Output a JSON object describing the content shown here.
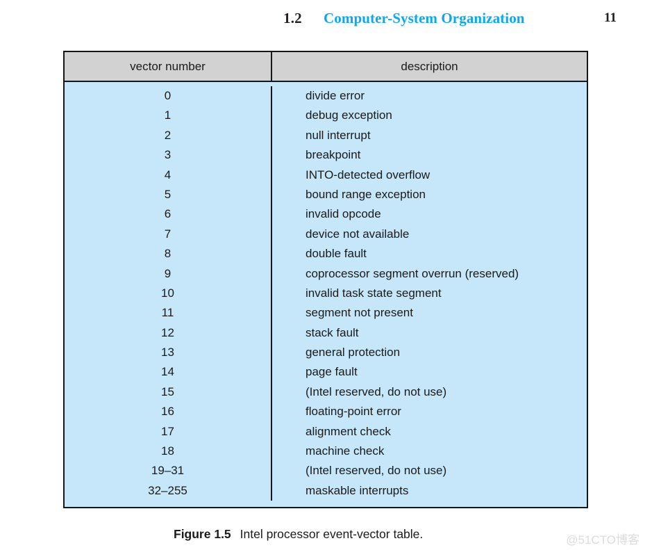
{
  "header": {
    "section_number": "1.2",
    "section_title": "Computer-System Organization",
    "page_number": "11",
    "title_color": "#0aa8f0"
  },
  "table": {
    "header_bg": "#d2d2d2",
    "body_bg": "#c6e7fa",
    "border_color": "#14161a",
    "columns": [
      "vector number",
      "description"
    ],
    "rows": [
      {
        "vector": "0",
        "description": "divide error"
      },
      {
        "vector": "1",
        "description": "debug exception"
      },
      {
        "vector": "2",
        "description": "null interrupt"
      },
      {
        "vector": "3",
        "description": "breakpoint"
      },
      {
        "vector": "4",
        "description": "INTO-detected overflow"
      },
      {
        "vector": "5",
        "description": "bound range exception"
      },
      {
        "vector": "6",
        "description": "invalid opcode"
      },
      {
        "vector": "7",
        "description": "device not available"
      },
      {
        "vector": "8",
        "description": "double fault"
      },
      {
        "vector": "9",
        "description": "coprocessor segment overrun (reserved)"
      },
      {
        "vector": "10",
        "description": "invalid task state segment"
      },
      {
        "vector": "11",
        "description": "segment not present"
      },
      {
        "vector": "12",
        "description": "stack fault"
      },
      {
        "vector": "13",
        "description": "general protection"
      },
      {
        "vector": "14",
        "description": "page fault"
      },
      {
        "vector": "15",
        "description": "(Intel reserved, do not use)"
      },
      {
        "vector": "16",
        "description": "floating-point error"
      },
      {
        "vector": "17",
        "description": "alignment check"
      },
      {
        "vector": "18",
        "description": "machine check"
      },
      {
        "vector": "19–31",
        "description": "(Intel reserved, do not use)"
      },
      {
        "vector": "32–255",
        "description": "maskable interrupts"
      }
    ]
  },
  "caption": {
    "label": "Figure 1.5",
    "text": "Intel processor event-vector table."
  },
  "watermark": {
    "text": "@51CTO博客"
  }
}
